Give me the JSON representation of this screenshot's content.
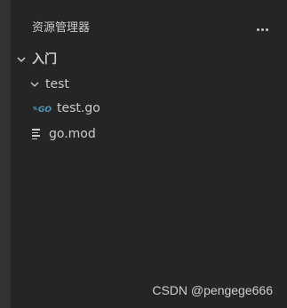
{
  "explorer": {
    "title": "资源管理器",
    "more_icon": "ellipsis-icon"
  },
  "tree": {
    "root": {
      "label": "入门",
      "expanded": true
    },
    "folder": {
      "label": "test",
      "expanded": true
    },
    "files": [
      {
        "label": "test.go",
        "icon": "go-file-icon",
        "icon_color": "#519aba"
      },
      {
        "label": "go.mod",
        "icon": "mod-file-icon"
      }
    ]
  },
  "watermark": "CSDN @pengege666",
  "colors": {
    "background": "#252526",
    "activity_strip": "#333333",
    "text": "#cccccc",
    "go_icon": "#519aba"
  }
}
